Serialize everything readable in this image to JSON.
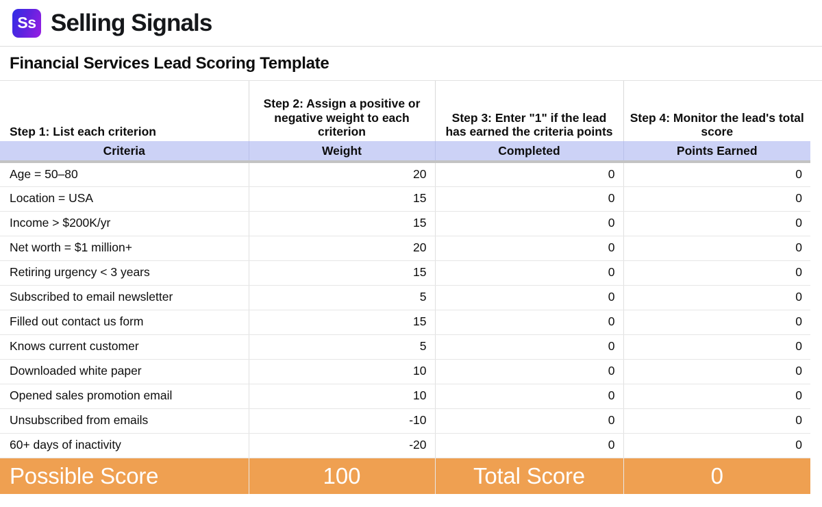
{
  "brand": {
    "logo_text": "Ss",
    "name": "Selling Signals",
    "logo_gradient_from": "#2f2fe6",
    "logo_gradient_to": "#9a1ee2"
  },
  "document": {
    "title": "Financial Services Lead Scoring Template"
  },
  "table": {
    "step_headers": [
      "Step 1: List each criterion",
      "Step 2: Assign a positive or negative weight to each criterion",
      "Step 3: Enter \"1\" if the lead has earned the criteria points",
      "Step 4: Monitor the lead's total score"
    ],
    "column_labels": [
      "Criteria",
      "Weight",
      "Completed",
      "Points Earned"
    ],
    "header_band_color": "#ccd2f6",
    "rows": [
      {
        "criteria": "Age = 50–80",
        "weight": "20",
        "completed": "0",
        "points": "0"
      },
      {
        "criteria": "Location = USA",
        "weight": "15",
        "completed": "0",
        "points": "0"
      },
      {
        "criteria": "Income > $200K/yr",
        "weight": "15",
        "completed": "0",
        "points": "0"
      },
      {
        "criteria": "Net worth = $1 million+",
        "weight": "20",
        "completed": "0",
        "points": "0"
      },
      {
        "criteria": "Retiring urgency < 3 years",
        "weight": "15",
        "completed": "0",
        "points": "0"
      },
      {
        "criteria": "Subscribed to email newsletter",
        "weight": "5",
        "completed": "0",
        "points": "0"
      },
      {
        "criteria": "Filled out contact us form",
        "weight": "15",
        "completed": "0",
        "points": "0"
      },
      {
        "criteria": "Knows current customer",
        "weight": "5",
        "completed": "0",
        "points": "0"
      },
      {
        "criteria": "Downloaded white paper",
        "weight": "10",
        "completed": "0",
        "points": "0"
      },
      {
        "criteria": "Opened sales promotion email",
        "weight": "10",
        "completed": "0",
        "points": "0"
      },
      {
        "criteria": "Unsubscribed from emails",
        "weight": "-10",
        "completed": "0",
        "points": "0"
      },
      {
        "criteria": "60+ days of inactivity",
        "weight": "-20",
        "completed": "0",
        "points": "0"
      }
    ],
    "footer": {
      "possible_score_label": "Possible Score",
      "possible_score_value": "100",
      "total_score_label": "Total Score",
      "total_score_value": "0",
      "background_color": "#efa051"
    }
  }
}
